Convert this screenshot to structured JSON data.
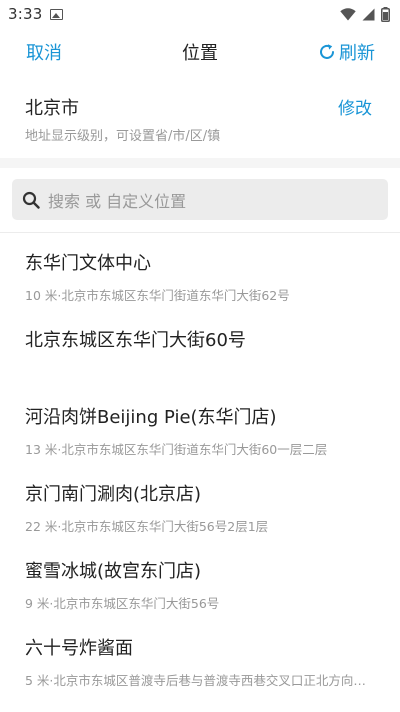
{
  "status": {
    "time": "3:33"
  },
  "nav": {
    "cancel": "取消",
    "title": "位置",
    "refresh": "刷新"
  },
  "current": {
    "city": "北京市",
    "edit": "修改",
    "hint": "地址显示级别，可设置省/市/区/镇"
  },
  "search": {
    "placeholder": "搜索 或 自定义位置"
  },
  "places": [
    {
      "name": "东华门文体中心",
      "addr": "10 米·北京市东城区东华门街道东华门大街62号"
    },
    {
      "name": "北京东城区东华门大街60号",
      "addr": ""
    },
    {
      "name": "河沿肉饼Beijing Pie(东华门店)",
      "addr": "13 米·北京市东城区东华门街道东华门大街60一层二层"
    },
    {
      "name": "京门南门涮肉(北京店)",
      "addr": "22 米·北京市东城区东华门大街56号2层1层"
    },
    {
      "name": "蜜雪冰城(故宫东门店)",
      "addr": "9 米·北京市东城区东华门大街56号"
    },
    {
      "name": "六十号炸酱面",
      "addr": "5 米·北京市东城区普渡寺后巷与普渡寺西巷交叉口正北方向…"
    }
  ],
  "colors": {
    "accent": "#1a95d6",
    "secondary_text": "#999999"
  }
}
